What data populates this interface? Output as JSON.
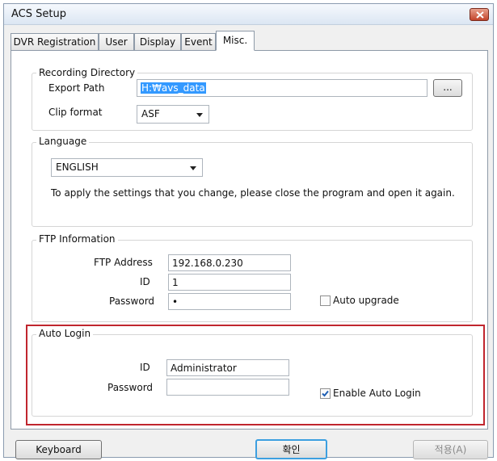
{
  "window": {
    "title": "ACS Setup"
  },
  "tabs": [
    {
      "label": "DVR Registration"
    },
    {
      "label": "User"
    },
    {
      "label": "Display"
    },
    {
      "label": "Event"
    },
    {
      "label": "Misc."
    }
  ],
  "active_tab": "Misc.",
  "recording_directory": {
    "title": "Recording Directory",
    "export_path_label": "Export Path",
    "export_path_value": "H:₩avs_data",
    "browse_label": "...",
    "clip_format_label": "Clip format",
    "clip_format_value": "ASF"
  },
  "language": {
    "title": "Language",
    "selected": "ENGLISH",
    "note": "To apply the settings that you change, please close the program and open it again."
  },
  "ftp": {
    "title": "FTP Information",
    "address_label": "FTP Address",
    "address_value": "192.168.0.230",
    "id_label": "ID",
    "id_value": "1",
    "password_label": "Password",
    "password_value": "•",
    "auto_upgrade_label": "Auto upgrade",
    "auto_upgrade_checked": false
  },
  "auto_login": {
    "title": "Auto Login",
    "id_label": "ID",
    "id_value": "Administrator",
    "password_label": "Password",
    "password_value": "",
    "enable_label": "Enable Auto Login",
    "enable_checked": true
  },
  "footer": {
    "keyboard_label": "Keyboard",
    "ok_label": "확인",
    "apply_label": "적용(A)"
  },
  "colors": {
    "highlight_border": "#c0262e",
    "selection": "#3399ff",
    "ok_focus": "#3c9fe0"
  }
}
